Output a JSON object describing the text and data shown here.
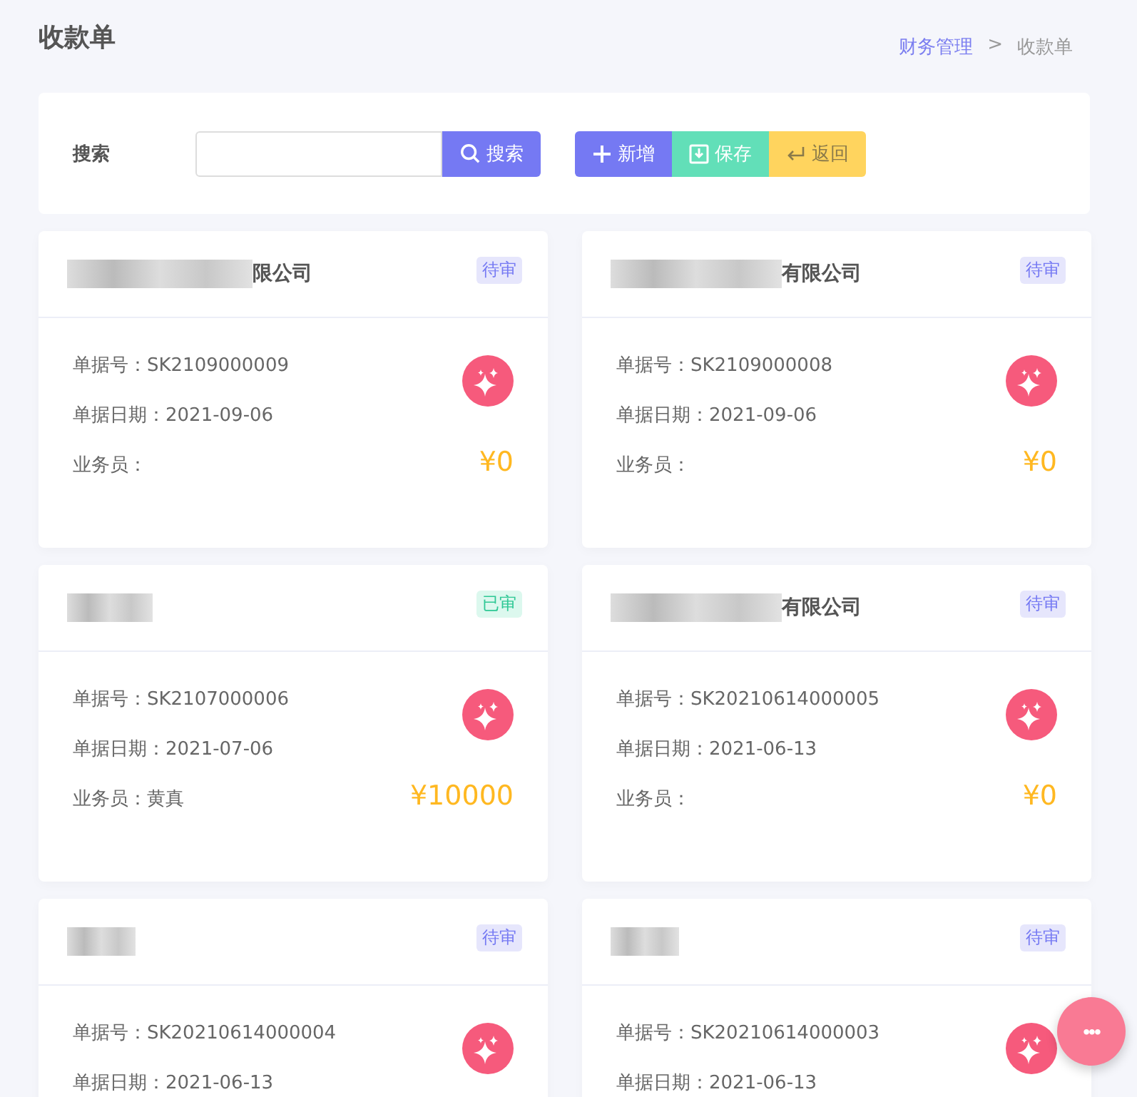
{
  "page_title": "收款单",
  "breadcrumb": [
    {
      "label": "财务管理",
      "link": true
    },
    {
      "label": ">",
      "link": false
    },
    {
      "label": "收款单",
      "link": false
    }
  ],
  "search": {
    "label": "搜索",
    "button": "搜索"
  },
  "actions": [
    {
      "kind": "add",
      "label": "新增"
    },
    {
      "kind": "save",
      "label": "保存"
    },
    {
      "kind": "back",
      "label": "返回"
    }
  ],
  "cards": [
    {
      "name_visible": "限公司",
      "status": "待审",
      "approved": false,
      "number_label": "单据号：",
      "number": "SK2109000009",
      "date_label": "单据日期：",
      "date": "2021-09-06",
      "clerk_label": "业务员：",
      "amount": "¥0"
    },
    {
      "name_visible": "有限公司",
      "status": "待审",
      "approved": false,
      "number_label": "单据号：",
      "number": "SK2109000008",
      "date_label": "单据日期：",
      "date": "2021-09-06",
      "clerk_label": "业务员：",
      "amount": "¥0"
    },
    {
      "status": "已审",
      "approved": true,
      "number_label": "单据号：",
      "number": "SK2107000006",
      "date_label": "单据日期：",
      "date": "2021-07-06",
      "clerk_label": "业务员：",
      "clerk": "黄真",
      "amount": "¥10000"
    },
    {
      "name_visible": "有限公司",
      "status": "待审",
      "approved": false,
      "number_label": "单据号：",
      "number": "SK20210614000005",
      "date_label": "单据日期：",
      "date": "2021-06-13",
      "clerk_label": "业务员：",
      "amount": "¥0"
    },
    {
      "status": "待审",
      "approved": false,
      "number_label": "单据号：",
      "number": "SK20210614000004",
      "date_label": "单据日期：",
      "date": "2021-06-13"
    },
    {
      "status": "待审",
      "approved": false,
      "number_label": "单据号：",
      "number": "SK20210614000003",
      "date_label": "单据日期：",
      "date": "2021-06-13"
    }
  ],
  "fab": {
    "label": "•••"
  }
}
